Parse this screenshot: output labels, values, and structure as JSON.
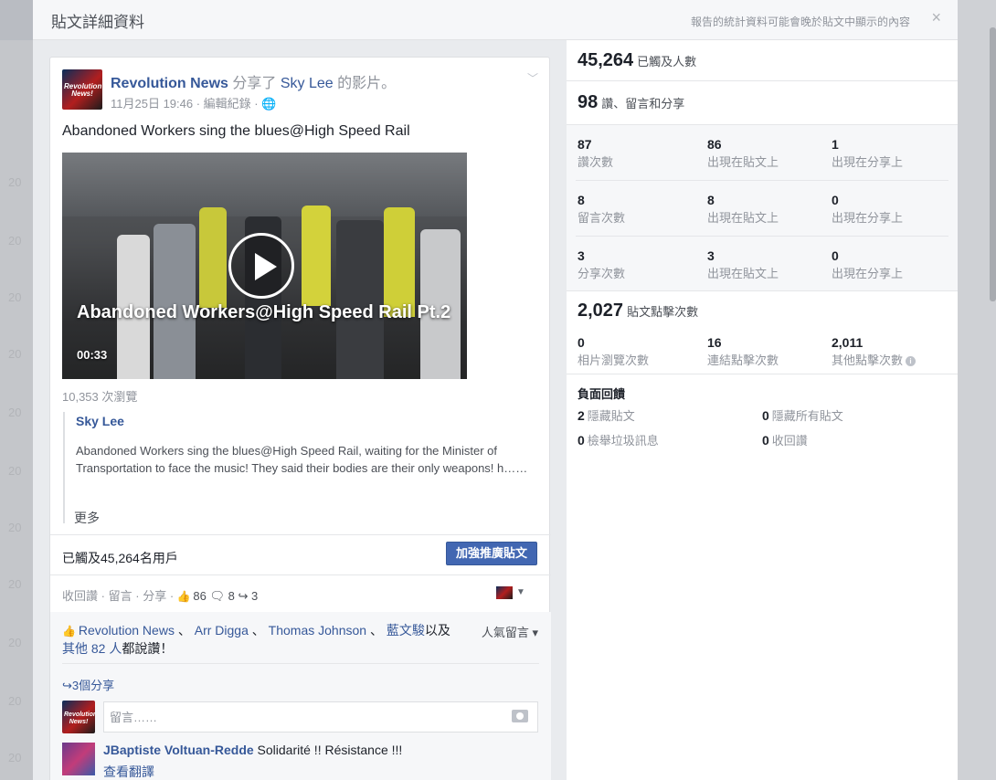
{
  "background": {
    "years": [
      "20",
      "20",
      "20",
      "20",
      "20",
      "20",
      "20",
      "20",
      "20",
      "20",
      "20",
      "20"
    ]
  },
  "dialog": {
    "title": "貼文詳細資料",
    "note": "報告的統計資料可能會晚於貼文中顯示的內容",
    "close": "×"
  },
  "post": {
    "author": "Revolution News",
    "shared_prefix": "分享了",
    "shared_target": "Sky Lee",
    "shared_suffix": "的影片。",
    "meta": "11月25日 19:46 · 編輯紀錄 · 🌐",
    "avatar_text": "Revolution News!",
    "text": "Abandoned Workers sing the blues@High Speed Rail",
    "video": {
      "title": "Abandoned Workers@High Speed Rail Pt.2",
      "duration": "00:33"
    },
    "views": "10,353 次瀏覽",
    "quote": {
      "name": "Sky Lee",
      "text": "Abandoned Workers sing the blues@High Speed Rail, waiting for the Minister of Transportation to face the music! They said their bodies are their only weapons! h……",
      "more": "更多"
    },
    "reach": "已觸及45,264名用戶",
    "boost_label": "加強推廣貼文",
    "actions": {
      "reply": "收回讚",
      "comment": "留言",
      "share": "分享",
      "likes": "86",
      "comments": "8",
      "shares": "3"
    },
    "social": {
      "names": [
        "Revolution News",
        "Arr Digga",
        "Thomas Johnson"
      ],
      "sep": "、",
      "last_name": "藍文駿",
      "tail": "以及",
      "others_prefix": "其他",
      "others_count": "82",
      "others_suffix": "人",
      "liked": "都說讚！",
      "top_comments": "人氣留言 ▾",
      "shares_line": "3個分享",
      "comment_placeholder": "留言……"
    },
    "comment": {
      "author": "JBaptiste Voltuan-Redde",
      "text": "Solidarité !! Résistance !!!",
      "translate": "查看翻譯"
    }
  },
  "stats": {
    "reach": {
      "value": "45,264",
      "label": "已觸及人數"
    },
    "engagement": {
      "value": "98",
      "label": "讚、留言和分享"
    },
    "grid": [
      [
        {
          "n": "87",
          "l": "讚次數"
        },
        {
          "n": "86",
          "l": "出現在貼文上"
        },
        {
          "n": "1",
          "l": "出現在分享上"
        }
      ],
      [
        {
          "n": "8",
          "l": "留言次數"
        },
        {
          "n": "8",
          "l": "出現在貼文上"
        },
        {
          "n": "0",
          "l": "出現在分享上"
        }
      ],
      [
        {
          "n": "3",
          "l": "分享次數"
        },
        {
          "n": "3",
          "l": "出現在貼文上"
        },
        {
          "n": "0",
          "l": "出現在分享上"
        }
      ]
    ],
    "clicks": {
      "value": "2,027",
      "label": "貼文點擊次數"
    },
    "click_breakdown": [
      {
        "n": "0",
        "l": "相片瀏覽次數"
      },
      {
        "n": "16",
        "l": "連結點擊次數"
      },
      {
        "n": "2,011",
        "l": "其他點擊次數"
      }
    ],
    "negative": {
      "title": "負面回饋",
      "items": [
        {
          "n": "2",
          "l": "隱藏貼文"
        },
        {
          "n": "0",
          "l": "隱藏所有貼文"
        },
        {
          "n": "0",
          "l": "檢舉垃圾訊息"
        },
        {
          "n": "0",
          "l": "收回讚"
        }
      ]
    }
  },
  "colors": {
    "link": "#365899",
    "boost": "#4267b2",
    "muted": "#90949c"
  }
}
